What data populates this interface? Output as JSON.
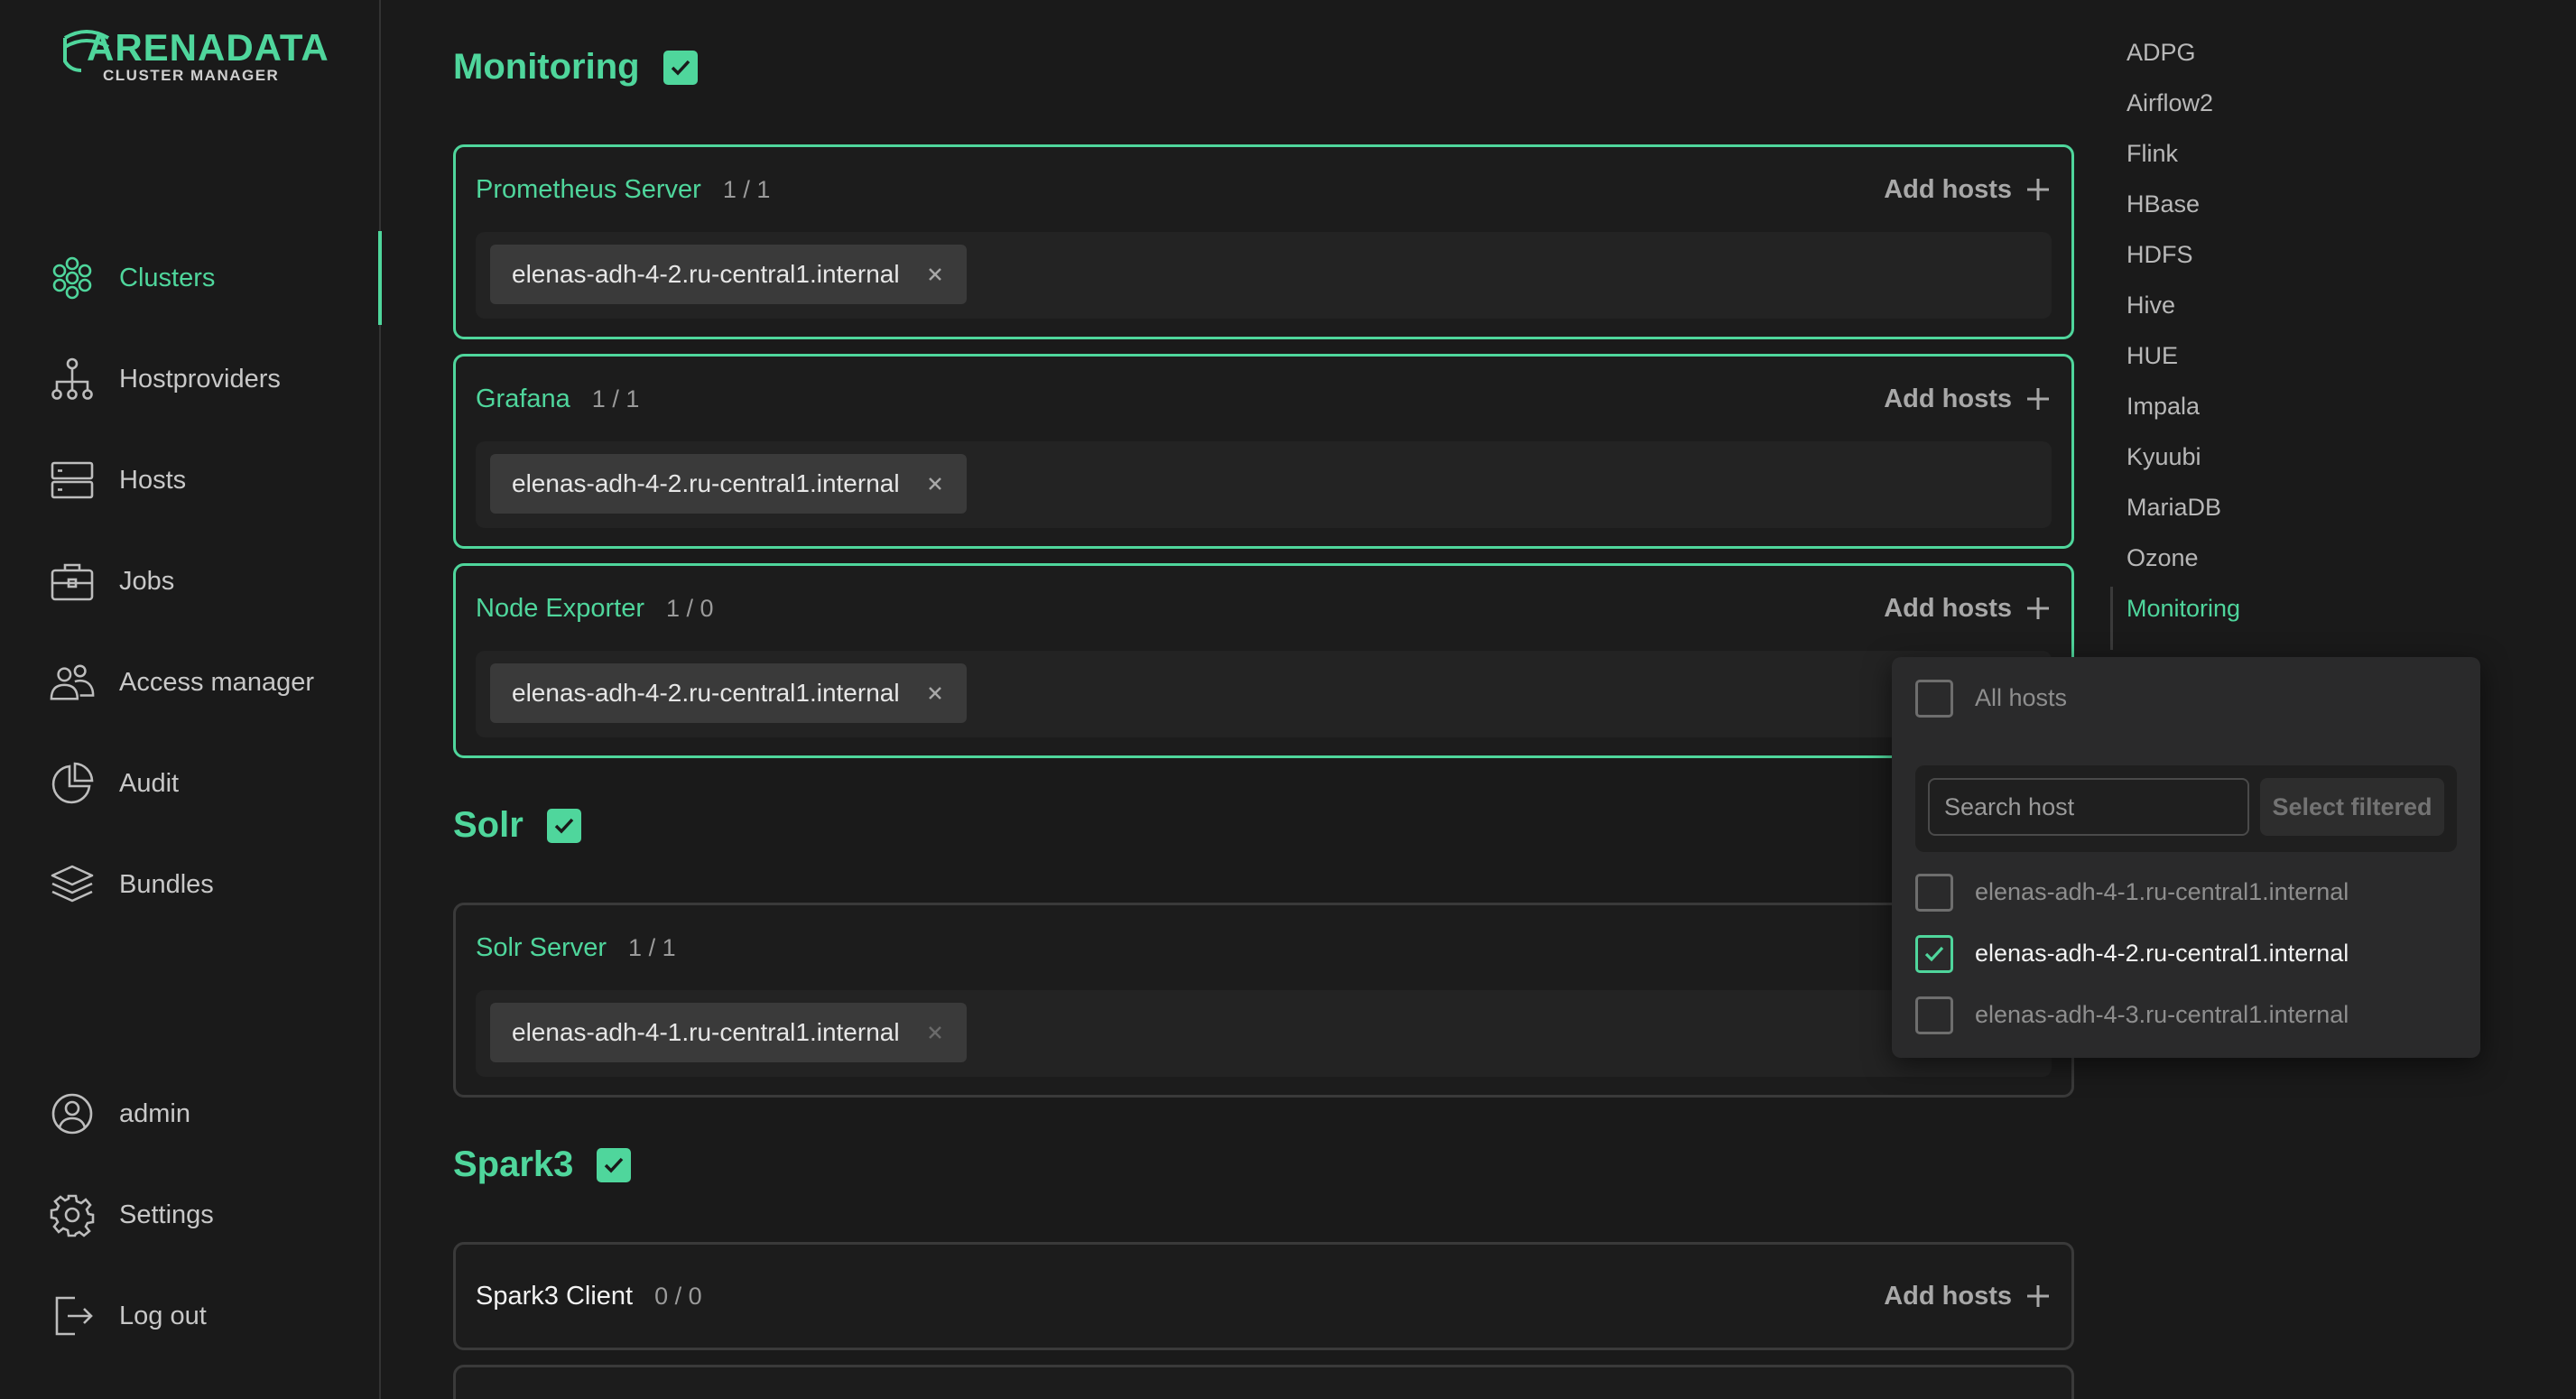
{
  "brand": {
    "name": "ARENADATA",
    "subtitle": "CLUSTER MANAGER",
    "accent": "#4fd69c"
  },
  "sidebar": {
    "items": [
      {
        "label": "Clusters",
        "icon": "clusters-icon",
        "active": true
      },
      {
        "label": "Hostproviders",
        "icon": "hostproviders-icon"
      },
      {
        "label": "Hosts",
        "icon": "hosts-icon"
      },
      {
        "label": "Jobs",
        "icon": "jobs-icon"
      },
      {
        "label": "Access manager",
        "icon": "access-manager-icon"
      },
      {
        "label": "Audit",
        "icon": "audit-icon"
      },
      {
        "label": "Bundles",
        "icon": "bundles-icon"
      }
    ],
    "bottom": [
      {
        "label": "admin",
        "icon": "user-icon"
      },
      {
        "label": "Settings",
        "icon": "gear-icon"
      },
      {
        "label": "Log out",
        "icon": "logout-icon"
      }
    ]
  },
  "main": {
    "add_hosts_label": "Add hosts",
    "sections": [
      {
        "title": "Monitoring",
        "checked": true,
        "components": [
          {
            "name": "Prometheus Server",
            "count": "1 / 1",
            "selected": true,
            "hosts": [
              "elenas-adh-4-2.ru-central1.internal"
            ]
          },
          {
            "name": "Grafana",
            "count": "1 / 1",
            "selected": true,
            "hosts": [
              "elenas-adh-4-2.ru-central1.internal"
            ]
          },
          {
            "name": "Node Exporter",
            "count": "1 / 0",
            "selected": true,
            "hosts": [
              "elenas-adh-4-2.ru-central1.internal"
            ]
          }
        ]
      },
      {
        "title": "Solr",
        "checked": true,
        "components": [
          {
            "name": "Solr Server",
            "count": "1 / 1",
            "selected": false,
            "hosts": [
              "elenas-adh-4-1.ru-central1.internal"
            ]
          }
        ]
      },
      {
        "title": "Spark3",
        "checked": true,
        "components": [
          {
            "name": "Spark3 Client",
            "count": "0 / 0",
            "selected": false,
            "hosts": []
          }
        ]
      }
    ]
  },
  "right_nav": {
    "items": [
      "ADPG",
      "Airflow2",
      "Flink",
      "HBase",
      "HDFS",
      "Hive",
      "HUE",
      "Impala",
      "Kyuubi",
      "MariaDB",
      "Ozone",
      "Monitoring"
    ],
    "active": "Monitoring"
  },
  "popup": {
    "all_hosts_label": "All hosts",
    "search_placeholder": "Search host",
    "select_filtered_label": "Select filtered",
    "hosts": [
      {
        "name": "elenas-adh-4-1.ru-central1.internal",
        "checked": false
      },
      {
        "name": "elenas-adh-4-2.ru-central1.internal",
        "checked": true
      },
      {
        "name": "elenas-adh-4-3.ru-central1.internal",
        "checked": false
      }
    ]
  }
}
